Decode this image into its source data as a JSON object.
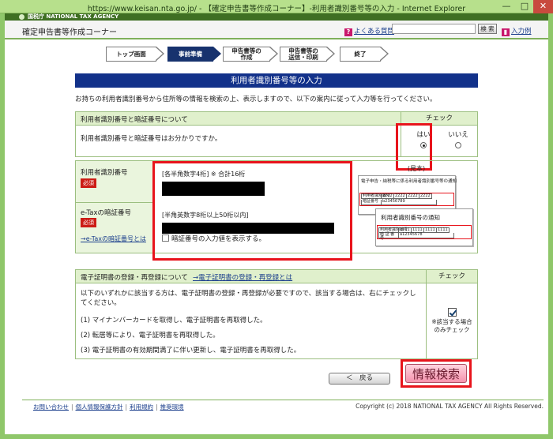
{
  "browser": {
    "title": "https://www.keisan.nta.go.jp/ - 【確定申告書等作成コーナー】-利用者識別番号等の入力 - Internet Explorer"
  },
  "agency": {
    "name": "国税庁 NATIONAL TAX AGENCY"
  },
  "header": {
    "site_name": "確定申告書等作成コーナー",
    "faq_label": "よくある質問",
    "search_placeholder": "",
    "search_button": "検 索",
    "entry_label": "入力例"
  },
  "steps": [
    {
      "label": "トップ画面",
      "active": false
    },
    {
      "label": "事前準備",
      "active": true
    },
    {
      "label": "申告書等の\n作成",
      "active": false
    },
    {
      "label": "申告書等の\n送信・印刷",
      "active": false
    },
    {
      "label": "終了",
      "active": false
    }
  ],
  "page": {
    "heading": "利用者識別番号等の入力",
    "intro": "お持ちの利用者識別番号から住所等の情報を検索の上、表示しますので、以下の案内に従って入力等を行ってください。"
  },
  "section1": {
    "header_label": "利用者識別番号と暗証番号について",
    "check_header": "チェック",
    "question": "利用者識別番号と暗証番号はお分かりですか。",
    "yes_label": "はい",
    "no_label": "いいえ",
    "selected": "yes"
  },
  "section2": {
    "id_label": "利用者識別番号",
    "required": "必須",
    "id_hint": "[各半角数字4桁] ※ 合計16桁",
    "pw_label": "e-Taxの暗証番号",
    "pw_link": "→e-Taxの暗証番号とは",
    "pw_hint": "[半角英数字8桁以上50桁以内]",
    "show_pw": "暗証番号の入力値を表示する。",
    "sample": {
      "title": "(見本)",
      "card1_title": "電子申告・納税等に係る利用者識別番号等の通知",
      "card1_row_key": "利用者識別番号",
      "card1_values": [
        "2222",
        "2222",
        "2222",
        "2222"
      ],
      "card1_sub_key": "暗証番号",
      "card1_sub_value": "b23456789",
      "card2_title": "利用者識別番号の通知",
      "card2_row_key": "利用者識別番号",
      "card2_values": [
        "1111",
        "1111",
        "1111",
        "1111"
      ],
      "card2_sub_key": "暗 証 番 号",
      "card2_sub_value": "a12345678"
    }
  },
  "section3": {
    "header_label": "電子証明書の登録・再登録について",
    "header_link": "→電子証明書の登録・再登録とは",
    "check_header": "チェック",
    "description": "以下のいずれかに該当する方は、電子証明書の登録・再登録が必要ですので、該当する場合は、右にチェックしてください。",
    "items": [
      "(1) マイナンバーカードを取得し、電子証明書を再取得した。",
      "(2) 転居等により、電子証明書を再取得した。",
      "(3) 電子証明書の有効期間満了に伴い更新し、電子証明書を再取得した。"
    ],
    "check_note": "※該当する場合\nのみチェック",
    "checked": true
  },
  "buttons": {
    "back": "＜　戻る",
    "search": "情報検索"
  },
  "footer": {
    "links": [
      "お問い合わせ",
      "個人情報保護方針",
      "利用規約",
      "推奨環境"
    ],
    "copyright": "Copyright (c) 2018 NATIONAL TAX AGENCY All Rights Reserved."
  }
}
